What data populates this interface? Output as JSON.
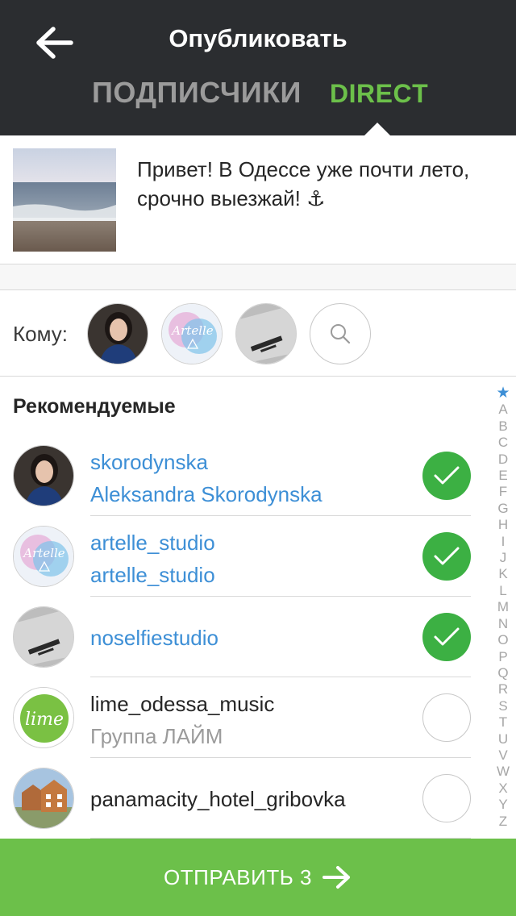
{
  "header": {
    "title": "Опубликовать",
    "back_icon": "arrow-left-icon",
    "tabs": [
      {
        "label": "ПОДПИСЧИКИ",
        "active": false
      },
      {
        "label": "DIRECT",
        "active": true
      }
    ]
  },
  "post": {
    "caption": "Привет! В Одессе уже почти лето, срочно выезжай! ⚓"
  },
  "recipients": {
    "label": "Кому:",
    "search_icon": "search-icon"
  },
  "suggested": {
    "title": "Рекомендуемые",
    "items": [
      {
        "username": "skorodynska",
        "full_name": "Aleksandra Skorodynska",
        "selected": true
      },
      {
        "username": "artelle_studio",
        "full_name": "artelle_studio",
        "selected": true
      },
      {
        "username": "noselfiestudio",
        "full_name": "",
        "selected": true
      },
      {
        "username": "lime_odessa_music",
        "full_name": "Группа ЛАЙМ",
        "selected": false
      },
      {
        "username": "panamacity_hotel_gribovka",
        "full_name": "",
        "selected": false
      }
    ]
  },
  "index": [
    "★",
    "A",
    "B",
    "C",
    "D",
    "E",
    "F",
    "G",
    "H",
    "I",
    "J",
    "K",
    "L",
    "M",
    "N",
    "O",
    "P",
    "Q",
    "R",
    "S",
    "T",
    "U",
    "V",
    "W",
    "X",
    "Y",
    "Z"
  ],
  "send": {
    "label": "ОТПРАВИТЬ 3"
  },
  "colors": {
    "header_bg": "#2b2d30",
    "accent_green": "#6cc04a",
    "check_green": "#3cb043",
    "link_blue": "#3d8fd6"
  }
}
